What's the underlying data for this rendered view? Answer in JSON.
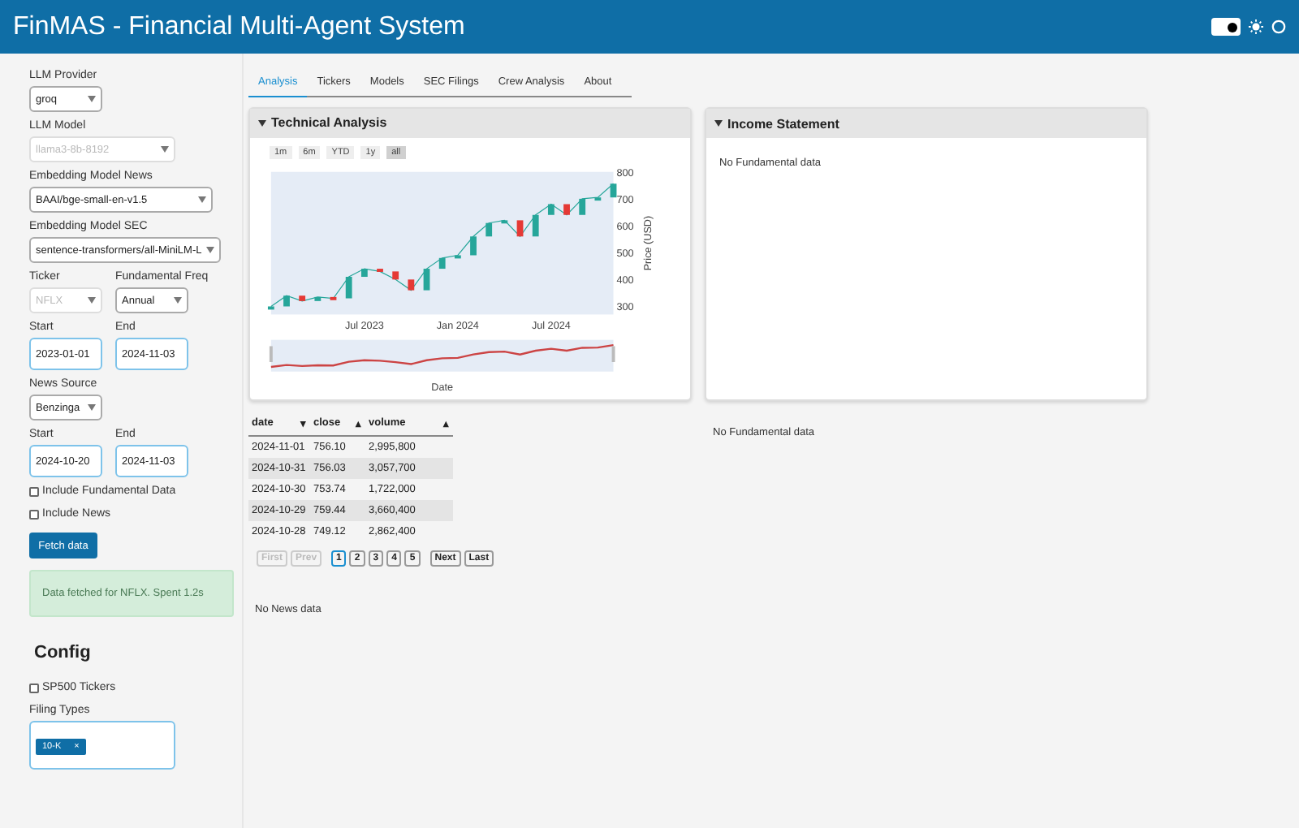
{
  "header": {
    "title": "FinMAS - Financial Multi-Agent System",
    "dark_mode_toggle": {
      "on": true
    }
  },
  "sidebar": {
    "fields": [
      {
        "kind": "select",
        "label": "LLM Provider",
        "value": "groq",
        "disabled": false
      },
      {
        "kind": "select",
        "label": "LLM Model",
        "value": "llama3-8b-8192",
        "disabled": true
      },
      {
        "kind": "select",
        "label": "Embedding Model News",
        "value": "BAAI/bge-small-en-v1.5",
        "disabled": false
      },
      {
        "kind": "select",
        "label": "Embedding Model SEC",
        "value": "sentence-transformers/all-MiniLM-L",
        "disabled": false
      }
    ],
    "pairs": [
      [
        {
          "kind": "select",
          "label": "Ticker",
          "value": "NFLX",
          "disabled": true
        },
        {
          "kind": "select",
          "label": "Fundamental Freq",
          "value": "Annual",
          "disabled": false
        }
      ],
      [
        {
          "kind": "input",
          "label": "Start",
          "value": "2023-01-01"
        },
        {
          "kind": "input",
          "label": "End",
          "value": "2024-11-03"
        }
      ]
    ],
    "news_source": {
      "label": "News Source",
      "value": "Benzinga"
    },
    "news_dates": [
      {
        "kind": "input",
        "label": "Start",
        "value": "2024-10-20"
      },
      {
        "kind": "input",
        "label": "End",
        "value": "2024-11-03"
      }
    ],
    "checkboxes": [
      {
        "label": "Include Fundamental Data",
        "checked": false
      },
      {
        "label": "Include News",
        "checked": false
      }
    ],
    "fetch_button": "Fetch data",
    "alert": "Data fetched for NFLX. Spent 1.2s",
    "config": {
      "title": "Config",
      "checkbox": {
        "label": "SP500 Tickers",
        "checked": false
      },
      "filing_types": {
        "label": "Filing Types",
        "tags": [
          {
            "label": "10-K",
            "remove": "×"
          }
        ]
      }
    }
  },
  "tabs": [
    {
      "label": "Analysis",
      "selected": true
    },
    {
      "label": "Tickers",
      "selected": false
    },
    {
      "label": "Models",
      "selected": false
    },
    {
      "label": "SEC Filings",
      "selected": false
    },
    {
      "label": "Crew Analysis",
      "selected": false
    },
    {
      "label": "About",
      "selected": false
    }
  ],
  "technical": {
    "title": "Technical Analysis",
    "expanded": true,
    "range_buttons": [
      {
        "label": "1m",
        "selected": false
      },
      {
        "label": "6m",
        "selected": false
      },
      {
        "label": "YTD",
        "selected": false
      },
      {
        "label": "1y",
        "selected": false
      },
      {
        "label": "all",
        "selected": true
      }
    ],
    "chart_data": {
      "type": "line",
      "xlabel": "Date",
      "ylabel": "Price (USD)",
      "categories": [
        null,
        null,
        null,
        null,
        null,
        null,
        "Jul 2023",
        null,
        null,
        null,
        null,
        null,
        "Jan 2024",
        null,
        null,
        null,
        null,
        null,
        "Jul 2024",
        null,
        null,
        null,
        null
      ],
      "series": [
        {
          "color": "#26a69a",
          "values": [
            300,
            340,
            320,
            335,
            330,
            410,
            440,
            430,
            400,
            360,
            440,
            480,
            490,
            560,
            610,
            620,
            560,
            640,
            680,
            640,
            700,
            705,
            756
          ]
        }
      ],
      "ylim": [
        270,
        800
      ],
      "yticks": [
        300,
        400,
        500,
        600,
        700,
        800
      ]
    }
  },
  "table": {
    "columns": [
      {
        "label": "date",
        "sort": "▾"
      },
      {
        "label": "close",
        "sort": "▴"
      },
      {
        "label": "volume",
        "sort": "▴"
      }
    ],
    "rows": [
      [
        "2024-11-01",
        "756.10",
        "2,995,800"
      ],
      [
        "2024-10-31",
        "756.03",
        "3,057,700"
      ],
      [
        "2024-10-30",
        "753.74",
        "1,722,000"
      ],
      [
        "2024-10-29",
        "759.44",
        "3,660,400"
      ],
      [
        "2024-10-28",
        "749.12",
        "2,862,400"
      ]
    ],
    "pagination": [
      [
        {
          "label": "First",
          "disabled": true,
          "selected": false
        },
        {
          "label": "Prev",
          "disabled": true,
          "selected": false
        }
      ],
      [
        {
          "label": "1",
          "disabled": false,
          "selected": true
        },
        {
          "label": "2",
          "disabled": false,
          "selected": false
        },
        {
          "label": "3",
          "disabled": false,
          "selected": false
        },
        {
          "label": "4",
          "disabled": false,
          "selected": false
        },
        {
          "label": "5",
          "disabled": false,
          "selected": false
        }
      ],
      [
        {
          "label": "Next",
          "disabled": false,
          "selected": false
        },
        {
          "label": "Last",
          "disabled": false,
          "selected": false
        }
      ]
    ]
  },
  "news": "No News data",
  "income": {
    "title": "Income Statement",
    "expanded": true,
    "message": "No Fundamental data"
  },
  "fundamental_note": "No Fundamental data"
}
